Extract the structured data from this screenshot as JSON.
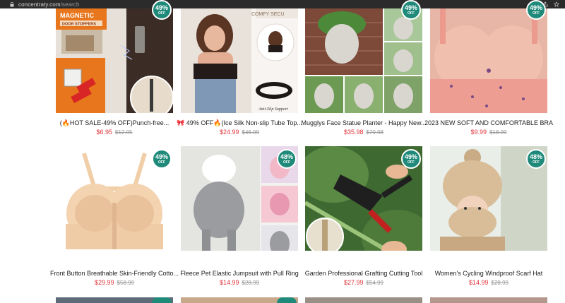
{
  "browser": {
    "url_domain": "concentraty.com",
    "url_path": "/search"
  },
  "products": [
    {
      "title": "(🔥HOT SALE-49% OFF)Punch-free...",
      "price": "$6.95",
      "old_price": "$12.95",
      "badge_pct": "49%",
      "badge_off": "OFF",
      "image_text_1": "MAGNETIC",
      "image_text_2": "DOOR STOPPERS"
    },
    {
      "title": "🎀 49% OFF🔥(Ice Silk Non-slip Tube Top...",
      "price": "$24.99",
      "old_price": "$46.99",
      "badge_pct": "49%",
      "badge_off": "OFF",
      "image_text_1": "COMFY SECU",
      "image_text_2": "Anti-Slip Support"
    },
    {
      "title": "Mugglys Face Statue Planter - Happy New...",
      "price": "$35.98",
      "old_price": "$70.98",
      "badge_pct": "49%",
      "badge_off": "OFF"
    },
    {
      "title": "2023 NEW SOFT AND COMFORTABLE BRA",
      "price": "$9.99",
      "old_price": "$18.99",
      "badge_pct": "49%",
      "badge_off": "OFF"
    },
    {
      "title": "Front Button Breathable Skin-Friendly Cotto...",
      "price": "$29.99",
      "old_price": "$58.99",
      "badge_pct": "49%",
      "badge_off": "OFF"
    },
    {
      "title": "Fleece Pet Elastic Jumpsuit with Pull Ring",
      "price": "$14.99",
      "old_price": "$28.99",
      "badge_pct": "48%",
      "badge_off": "OFF"
    },
    {
      "title": "Garden Professional Grafting Cutting Tool",
      "price": "$27.99",
      "old_price": "$54.99",
      "badge_pct": "49%",
      "badge_off": "OFF"
    },
    {
      "title": "Women's Cycling Windproof Scarf Hat",
      "price": "$14.99",
      "old_price": "$28.99",
      "badge_pct": "48%",
      "badge_off": "OFF"
    }
  ]
}
